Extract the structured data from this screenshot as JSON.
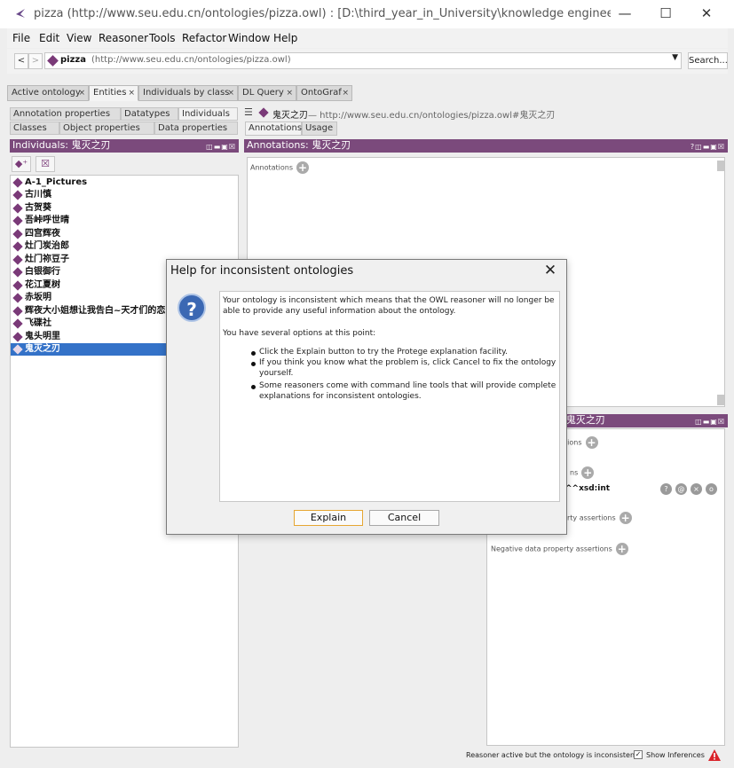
{
  "window": {
    "title": "pizza (http://www.seu.edu.cn/ontologies/pizza.owl)  : [D:\\third_year_in_University\\knowledge engineering\\exp..."
  },
  "menu": [
    "File",
    "Edit",
    "View",
    "Reasoner",
    "Tools",
    "Refactor",
    "Window",
    "Help"
  ],
  "address": {
    "back": "<",
    "forward": ">",
    "name": "pizza",
    "iri": "(http://www.seu.edu.cn/ontologies/pizza.owl)",
    "search_label": "Search..."
  },
  "tabs": [
    {
      "label": "Active ontology",
      "close": "×"
    },
    {
      "label": "Entities",
      "close": "×"
    },
    {
      "label": "Individuals by class",
      "close": "×"
    },
    {
      "label": "DL Query",
      "close": "×"
    },
    {
      "label": "OntoGraf",
      "close": "×"
    }
  ],
  "left": {
    "subtabs_row1": [
      "Annotation properties",
      "Datatypes",
      "Individuals"
    ],
    "subtabs_row2": [
      "Classes",
      "Object properties",
      "Data properties"
    ],
    "panel_title": "Individuals: 鬼灭之刃",
    "individuals": [
      "A-1_Pictures",
      "古川慎",
      "古贺葵",
      "吾峠呼世晴",
      "四宫辉夜",
      "灶门炭治郎",
      "灶门祢豆子",
      "白银御行",
      "花江夏树",
      "赤坂明",
      "辉夜大小姐想让我告白~天才们的恋",
      "飞碟社",
      "鬼头明里",
      "鬼灭之刃"
    ]
  },
  "right": {
    "header_name": "鬼灭之刃",
    "header_iri": "— http://www.seu.edu.cn/ontologies/pizza.owl#鬼灭之刃",
    "subtabs": [
      "Annotations",
      "Usage"
    ],
    "annotations_title": "Annotations: 鬼灭之刃",
    "annotations_label": "Annotations",
    "lower_title_partial": "ns: 鬼灭之刃",
    "row1_partial": "tions",
    "row2_partial": "ns",
    "xsd_partial": "^^xsd:int",
    "row3_partial": "perty assertions",
    "negative_label": "Negative data property assertions"
  },
  "status": {
    "text": "Reasoner active but the ontology is inconsistent",
    "show_inferences": "Show Inferences"
  },
  "dialog": {
    "title": "Help for inconsistent ontologies",
    "line1": "Your ontology is inconsistent which means that the OWL reasoner will no longer be",
    "line2": "able to provide any useful information about the ontology.",
    "line3": "You have several options at this point:",
    "b1": "Click the Explain button to try the Protege explanation facility.",
    "b2a": "If you think you know what the problem is, click Cancel to fix the ontology",
    "b2b": "yourself.",
    "b3a": "Some reasoners come with command line tools that will provide complete",
    "b3b": "explanations for inconsistent ontologies.",
    "explain": "Explain",
    "cancel": "Cancel"
  }
}
